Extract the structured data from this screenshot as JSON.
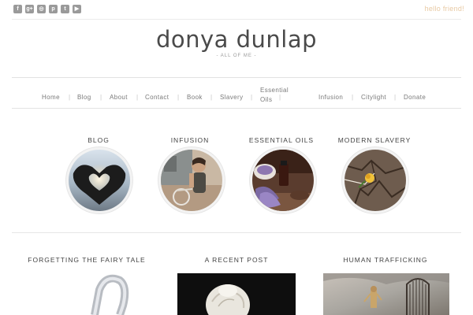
{
  "topbar": {
    "social_icons": [
      {
        "name": "facebook-icon",
        "glyph": "f"
      },
      {
        "name": "google-plus-icon",
        "glyph": "g+"
      },
      {
        "name": "instagram-icon",
        "glyph": "◎"
      },
      {
        "name": "pinterest-icon",
        "glyph": "p"
      },
      {
        "name": "twitter-icon",
        "glyph": "t"
      },
      {
        "name": "youtube-icon",
        "glyph": "▶"
      }
    ],
    "greeting": "hello friend!"
  },
  "header": {
    "title": "donya dunlap",
    "tagline": "- ALL OF ME -"
  },
  "nav": {
    "items": [
      {
        "label": "Home"
      },
      {
        "label": "Blog"
      },
      {
        "label": "About"
      },
      {
        "label": "Contact"
      },
      {
        "label": "Book"
      },
      {
        "label": "Slavery"
      },
      {
        "label": "Essential Oils",
        "line1": "Essential",
        "line2": "Oils"
      },
      {
        "label": "Infusion"
      },
      {
        "label": "Citylight"
      },
      {
        "label": "Donate"
      }
    ]
  },
  "features": [
    {
      "label": "BLOG"
    },
    {
      "label": "INFUSION"
    },
    {
      "label": "ESSENTIAL OILS"
    },
    {
      "label": "MODERN SLAVERY"
    }
  ],
  "widgets": [
    {
      "title": "FORGETTING THE FAIRY TALE"
    },
    {
      "title": "A RECENT POST"
    },
    {
      "title": "HUMAN TRAFFICKING"
    }
  ],
  "colors": {
    "accent": "#e8c9a3",
    "text": "#444444",
    "muted": "#7a7a7a"
  }
}
